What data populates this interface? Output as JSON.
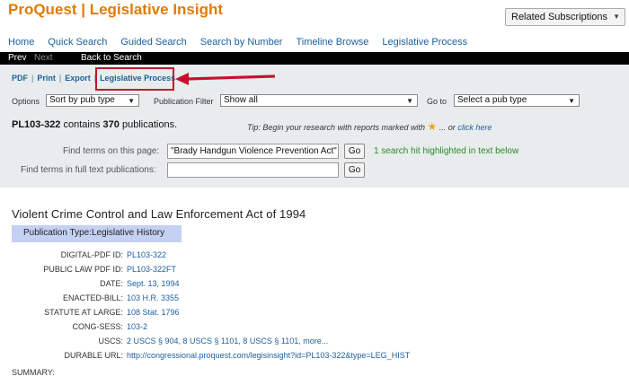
{
  "app_title": "ProQuest | Legislative Insight",
  "related_subscriptions": "Related Subscriptions",
  "nav": [
    "Home",
    "Quick Search",
    "Guided Search",
    "Search by Number",
    "Timeline Browse",
    "Legislative Process"
  ],
  "pager": {
    "prev": "Prev",
    "next": "Next",
    "back": "Back to Search"
  },
  "tools": {
    "pdf": "PDF",
    "print": "Print",
    "export": "Export",
    "legislative_process": "Legislative Process"
  },
  "options": {
    "options_label": "Options",
    "sort_value": "Sort by pub type",
    "filter_label": "Publication Filter",
    "filter_value": "Show all",
    "goto_label": "Go to",
    "goto_value": "Select a pub type"
  },
  "results": {
    "id": "PL103-322",
    "contains_text": "contains",
    "count": "370",
    "publications_text": "publications."
  },
  "tip": {
    "prefix": "Tip: Begin your research with reports marked with",
    "middle": "... or",
    "link": "click here"
  },
  "find": {
    "page_label": "Find terms on this page:",
    "page_value": "\"Brady Handgun Violence Prevention Act\"",
    "go": "Go",
    "hit_text": "1 search hit highlighted in text below",
    "full_label": "Find terms in full text publications:",
    "full_value": ""
  },
  "document": {
    "title": "Violent Crime Control and Law Enforcement Act of 1994",
    "pub_type": "Publication Type:Legislative History",
    "fields": [
      {
        "key": "DIGITAL-PDF ID:",
        "value": "PL103-322"
      },
      {
        "key": "PUBLIC LAW PDF ID:",
        "value": "PL103-322FT"
      },
      {
        "key": "DATE:",
        "value": "Sept. 13, 1994"
      },
      {
        "key": "ENACTED-BILL:",
        "value": "103 H.R. 3355"
      },
      {
        "key": "STATUTE AT LARGE:",
        "value": "108 Stat. 1796"
      },
      {
        "key": "CONG-SESS:",
        "value": "103-2"
      },
      {
        "key": "USCS:",
        "value": "2 USCS § 904, 8 USCS § 1101, 8 USCS § 1101, more..."
      },
      {
        "key": "DURABLE URL:",
        "value": "http://congressional.proquest.com/legisinsight?id=PL103-322&type=LEG_HIST"
      }
    ],
    "summary_label": "SUMMARY:"
  },
  "colors": {
    "brand": "#e07b00",
    "link": "#1c5f9c",
    "highlight_box": "#c8102e",
    "hit": "#2a8a2a",
    "pubtype_bg": "#c4d0f4"
  }
}
